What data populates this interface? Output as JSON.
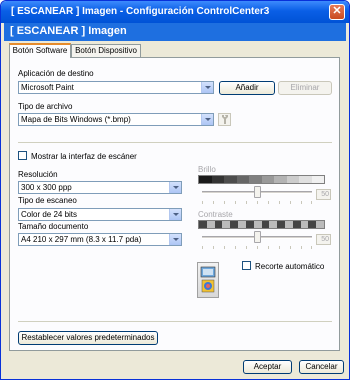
{
  "window": {
    "title": "[ ESCANEAR ]   Imagen - Configuración ControlCenter3",
    "close": "✕"
  },
  "banner": {
    "title": "[ ESCANEAR ]   Imagen"
  },
  "tabs": [
    {
      "label": "Botón Software",
      "active": true
    },
    {
      "label": "Botón Dispositivo",
      "active": false
    }
  ],
  "destino": {
    "label": "Aplicación de destino",
    "value": "Microsoft Paint",
    "add_label": "Añadir",
    "remove_label": "Eliminar"
  },
  "tipo_archivo": {
    "label": "Tipo de archivo",
    "value": "Mapa de Bits Windows (*.bmp)"
  },
  "show_scanner": {
    "label": "Mostrar la interfaz de escáner",
    "checked": false
  },
  "resolucion": {
    "label": "Resolución",
    "value": "300 x 300 ppp"
  },
  "tipo_escaneo": {
    "label": "Tipo de escaneo",
    "value": "Color de 24 bits"
  },
  "tamano": {
    "label": "Tamaño documento",
    "value": "A4 210 x 297 mm (8.3 x 11.7 pda)"
  },
  "brillo": {
    "label": "Brillo",
    "value": "50"
  },
  "contraste": {
    "label": "Contraste",
    "value": "50"
  },
  "recorte": {
    "label": "Recorte automático",
    "checked": false
  },
  "reset_label": "Restablecer valores predeterminados",
  "footer": {
    "accept": "Aceptar",
    "cancel": "Cancelar"
  },
  "colors": {
    "title_blue": "#0a5fe6",
    "banner_blue": "#1e6fe0",
    "tab_accent": "#e68b2c"
  },
  "icons": {
    "close": "close-icon",
    "dropdown": "chevron-down-icon",
    "settings": "wrench-icon",
    "scan": "scan-preview-icon"
  }
}
